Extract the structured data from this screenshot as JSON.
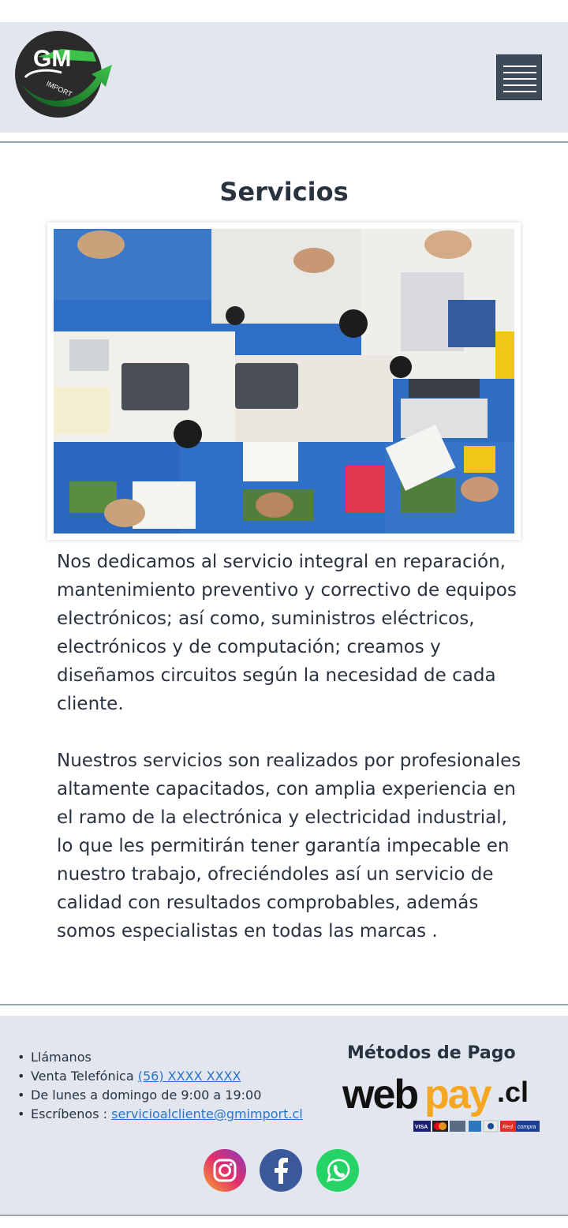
{
  "header": {
    "logo_text": "GM",
    "logo_sub": "IMPORT",
    "menu_icon": "hamburger-menu-icon"
  },
  "main": {
    "title": "Servicios",
    "paragraph_1": "Nos dedicamos al servicio integral en reparación, mantenimiento preventivo y correctivo de equipos electrónicos; así como, suministros eléctricos, electrónicos y de computación; creamos y diseñamos circuitos según la necesidad de cada cliente.",
    "paragraph_2": "Nuestros servicios son realizados por profesionales altamente capacitados, con amplia experiencia en el ramo de la electrónica y electricidad industrial, lo que les permitirán tener garantía impecable en nuestro trabajo, ofreciéndoles así un servicio de calidad con resultados comprobables, además somos especialistas en todas las marcas ."
  },
  "footer": {
    "call_label": "Llámanos",
    "phone_label": "Venta Telefónica",
    "phone_value": "(56) XXXX XXXX",
    "hours": "De lunes a domingo de 9:00 a 19:00",
    "email_label": "Escríbenos :",
    "email_value": "servicioalcliente@gmimport.cl",
    "payment_title": "Métodos de Pago",
    "webpay_brand": "webpay.cl",
    "card_logos": [
      "VISA",
      "MasterCard",
      "AMERICAN EXPRESS",
      "Redcompra"
    ],
    "social_icons": [
      "instagram-icon",
      "facebook-icon",
      "whatsapp-icon"
    ]
  },
  "colors": {
    "header_bg": "#e2e7ef",
    "menu_button": "#3e4a58",
    "text": "#2a3240",
    "link": "#2b73c7",
    "logo_green": "#2fae3a",
    "webpay_orange": "#f5a623"
  }
}
